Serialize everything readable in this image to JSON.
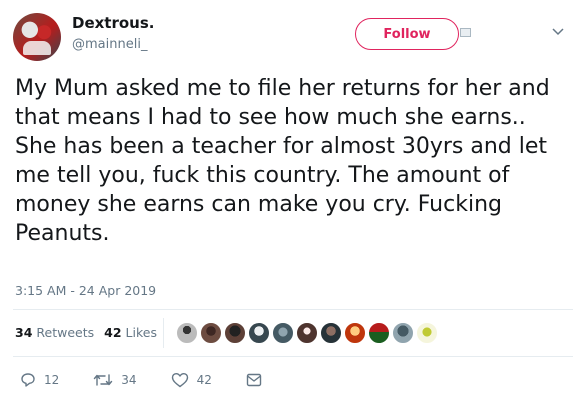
{
  "user": {
    "display_name": "Dextrous.",
    "handle": "@mainneli_"
  },
  "follow_button": {
    "label": "Follow"
  },
  "tweet": {
    "text": "My Mum asked me to file her returns for her and that means I had to see how much she earns.. She has been a teacher for almost 30yrs and let me tell you, fuck this country. The amount of money she earns can make you cry. Fucking Peanuts.",
    "timestamp": "3:15 AM - 24 Apr 2019"
  },
  "stats": {
    "retweets_count": "34",
    "retweets_label": "Retweets",
    "likes_count": "42",
    "likes_label": "Likes"
  },
  "actions": {
    "reply_count": "12",
    "retweet_count": "34",
    "like_count": "42"
  },
  "colors": {
    "accent": "#e0245e",
    "secondary_text": "#657786",
    "icon": "#657786"
  },
  "icons": {
    "reply": "reply-icon",
    "retweet": "retweet-icon",
    "like": "heart-icon",
    "message": "envelope-icon",
    "menu": "chevron-down-icon"
  }
}
